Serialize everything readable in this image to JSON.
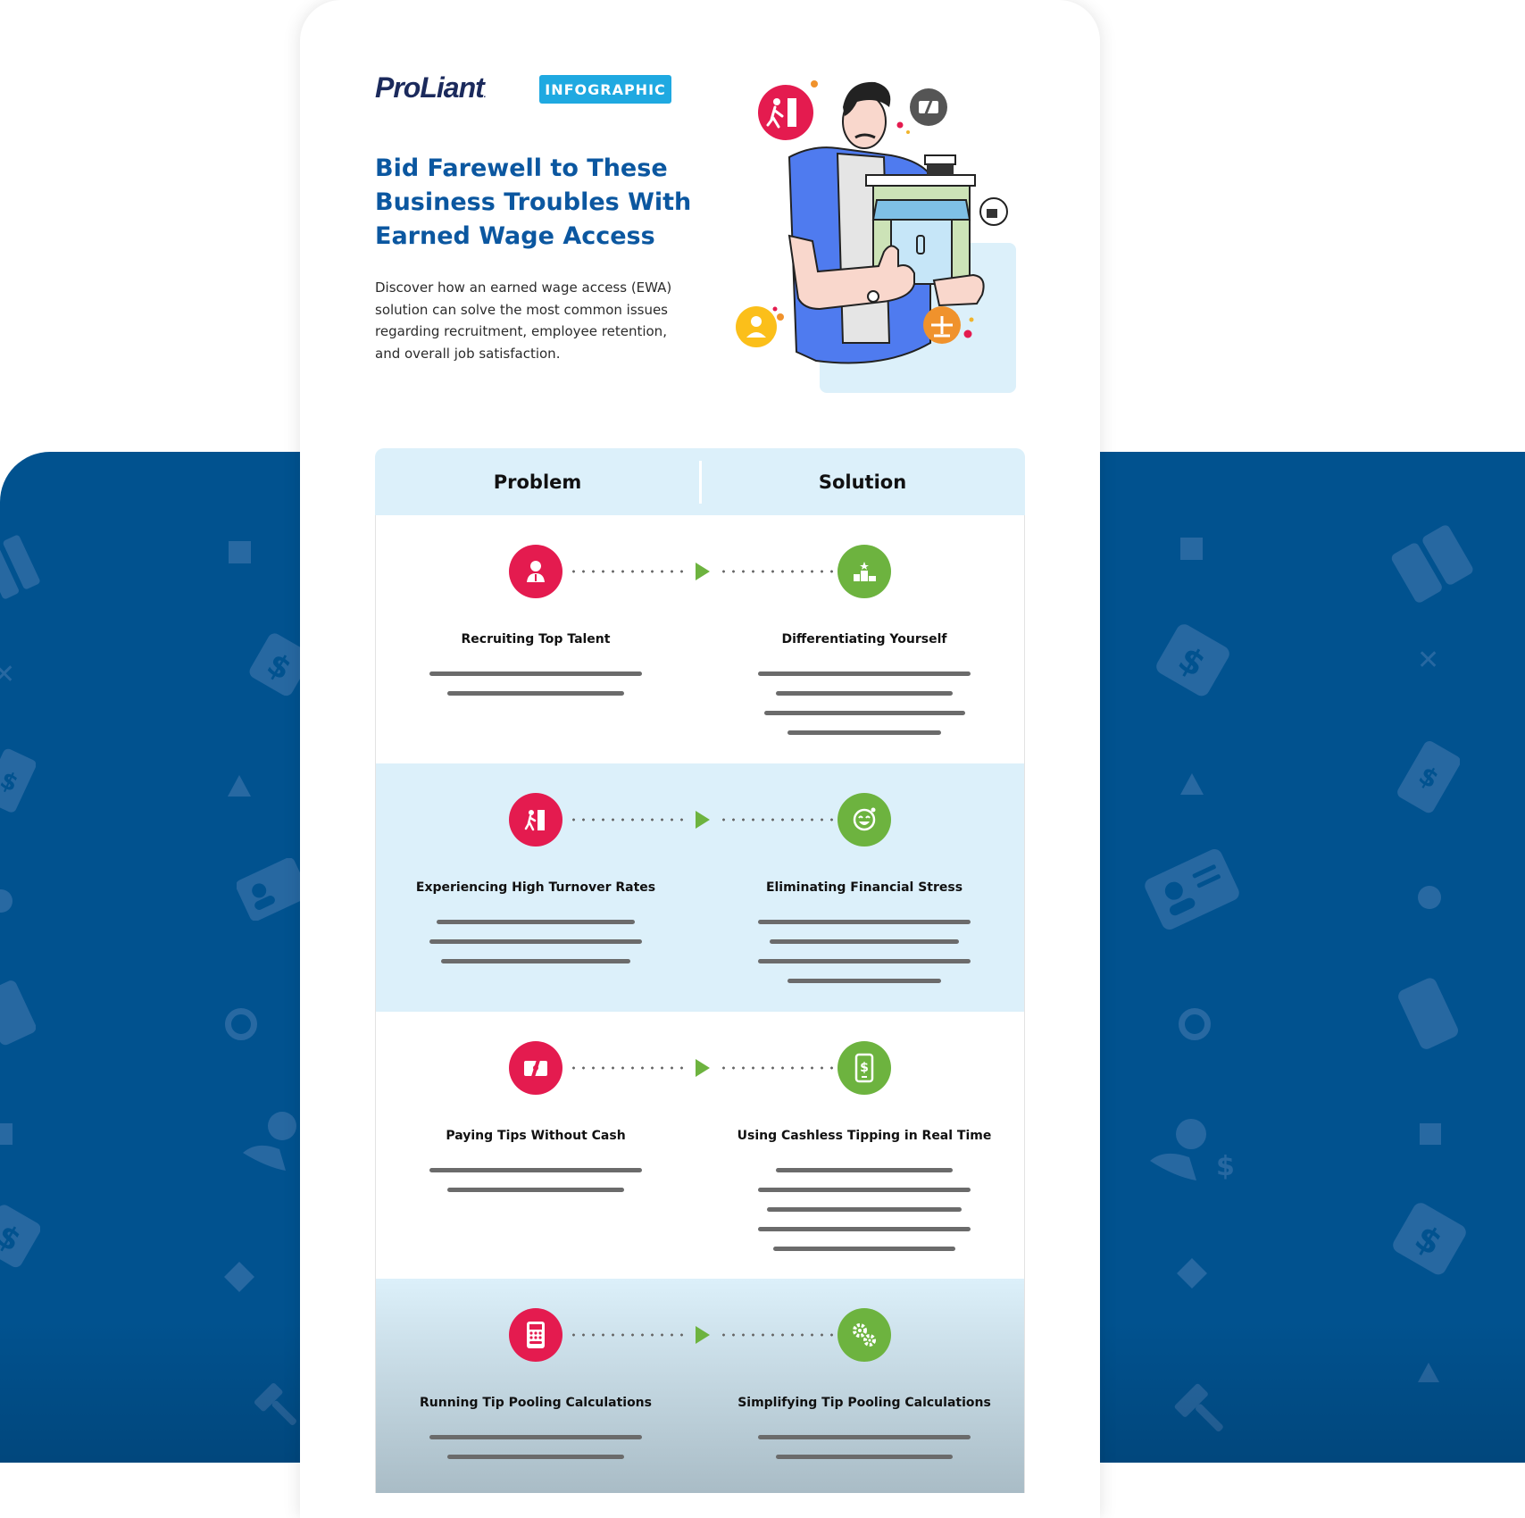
{
  "header": {
    "logo": "ProLiant",
    "logo_mark": ".",
    "badge": "INFOGRAPHIC",
    "title": "Bid Farewell to These Business Troubles With Earned Wage Access",
    "description": "Discover how an earned wage access (EWA) solution can solve the most common issues regarding recruitment, employee retention, and overall job satisfaction."
  },
  "illustration": {
    "subject": "man-holding-storefront",
    "floating_icons": [
      "exit-door-icon",
      "no-cash-icon",
      "employee-icon",
      "scales-icon",
      "coffee-icon"
    ]
  },
  "table": {
    "columns": [
      "Problem",
      "Solution"
    ],
    "rows": [
      {
        "problem": "Recruiting Top Talent",
        "problem_icon": "employee-icon",
        "problem_lines": 2,
        "solution": "Differentiating Yourself",
        "solution_icon": "podium-star-icon",
        "solution_lines": 4
      },
      {
        "problem": "Experiencing High Turnover Rates",
        "problem_icon": "exit-door-icon",
        "problem_lines": 3,
        "solution": "Eliminating Financial Stress",
        "solution_icon": "relieved-face-icon",
        "solution_lines": 4
      },
      {
        "problem": "Paying Tips Without Cash",
        "problem_icon": "no-cash-icon",
        "problem_lines": 2,
        "solution": "Using Cashless Tipping in Real Time",
        "solution_icon": "mobile-dollar-icon",
        "solution_lines": 5
      },
      {
        "problem": "Running Tip Pooling Calculations",
        "problem_icon": "calculator-icon",
        "problem_lines": 2,
        "solution": "Simplifying Tip Pooling Calculations",
        "solution_icon": "gears-icon",
        "solution_lines": 2
      }
    ]
  },
  "colors": {
    "brand_blue": "#01528f",
    "title_blue": "#0b57a0",
    "badge_blue": "#1fa9e1",
    "problem_red": "#e41b4f",
    "solution_green": "#6db33f",
    "row_tint": "#dcf0fa"
  }
}
